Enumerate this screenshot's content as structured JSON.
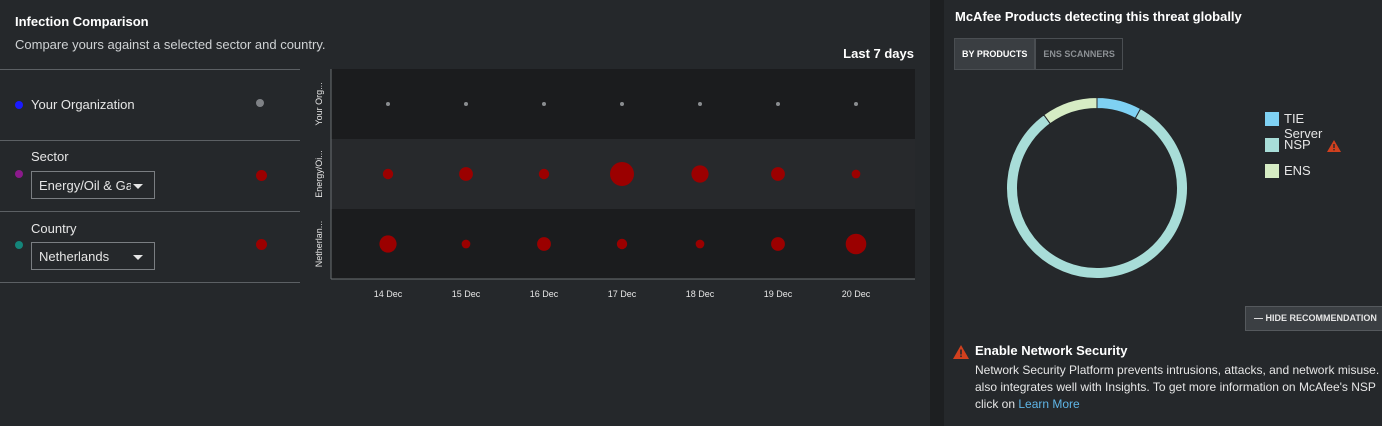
{
  "infection": {
    "title": "Infection Comparison",
    "subtitle": "Compare yours against a selected sector and country.",
    "range_label": "Last 7 days",
    "rows": [
      {
        "label": "Your Organization",
        "dot_color": "#1a1aff"
      },
      {
        "label": "Sector",
        "dot_color": "#8b1a8b",
        "selected": "Energy/Oil & Ga"
      },
      {
        "label": "Country",
        "dot_color": "#14857a",
        "selected": "Netherlands"
      }
    ]
  },
  "chart_data": {
    "type": "scatter",
    "subtype": "bubble",
    "x": [
      "14 Dec",
      "15 Dec",
      "16 Dec",
      "17 Dec",
      "18 Dec",
      "19 Dec",
      "20 Dec"
    ],
    "y_categories": [
      "Your Org...",
      "Energy/Oi...",
      "Netherlan..."
    ],
    "series": [
      {
        "category": "Your Org...",
        "sizes": [
          1,
          1,
          1,
          1,
          1,
          1,
          1
        ],
        "color": "#8a8d90"
      },
      {
        "category": "Energy/Oi...",
        "sizes": [
          2,
          3,
          2,
          6,
          4,
          3,
          1.5
        ],
        "color": "#9b0000"
      },
      {
        "category": "Netherlan...",
        "sizes": [
          4,
          1.5,
          3,
          2,
          1.5,
          3,
          5
        ],
        "color": "#9b0000"
      }
    ]
  },
  "products": {
    "title": "McAfee Products detecting this threat globally",
    "tabs": [
      "BY PRODUCTS",
      "ENS SCANNERS"
    ],
    "donut": [
      {
        "name": "TIE Server",
        "value": 8,
        "color": "#7fd1f3"
      },
      {
        "name": "NSP",
        "value": 82,
        "color": "#a8ddd8"
      },
      {
        "name": "ENS",
        "value": 10,
        "color": "#d6ecc4"
      }
    ],
    "legend": [
      "TIE Server",
      "NSP",
      "ENS"
    ],
    "hide_button": "— HIDE RECOMMENDATION",
    "rec_title": "Enable Network Security",
    "rec_text": "Network Security Platform prevents intrusions, attacks, and network misuse. It also integrates well with Insights. To get more information on McAfee's NSP click on",
    "rec_link": "Learn More"
  }
}
